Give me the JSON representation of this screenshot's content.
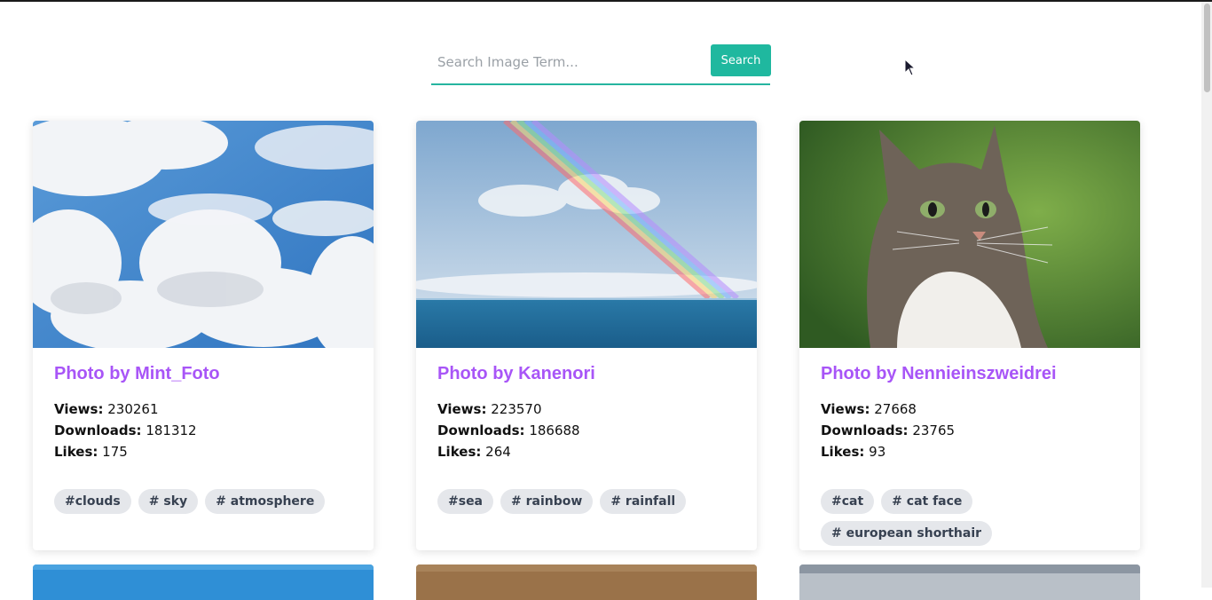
{
  "search": {
    "placeholder": "Search Image Term...",
    "button_label": "Search"
  },
  "cards": [
    {
      "title": "Photo by Mint_Foto",
      "views_label": "Views:",
      "views": "230261",
      "downloads_label": "Downloads:",
      "downloads": "181312",
      "likes_label": "Likes:",
      "likes": "175",
      "tags": [
        "#clouds",
        "# sky",
        "# atmosphere"
      ]
    },
    {
      "title": "Photo by Kanenori",
      "views_label": "Views:",
      "views": "223570",
      "downloads_label": "Downloads:",
      "downloads": "186688",
      "likes_label": "Likes:",
      "likes": "264",
      "tags": [
        "#sea",
        "# rainbow",
        "# rainfall"
      ]
    },
    {
      "title": "Photo by Nennieinszweidrei",
      "views_label": "Views:",
      "views": "27668",
      "downloads_label": "Downloads:",
      "downloads": "23765",
      "likes_label": "Likes:",
      "likes": "93",
      "tags": [
        "#cat",
        "# cat face",
        "# european shorthair"
      ]
    }
  ],
  "colors": {
    "accent": "#1fb89f",
    "title": "#a855f7",
    "tag_bg": "#e5e7eb"
  }
}
